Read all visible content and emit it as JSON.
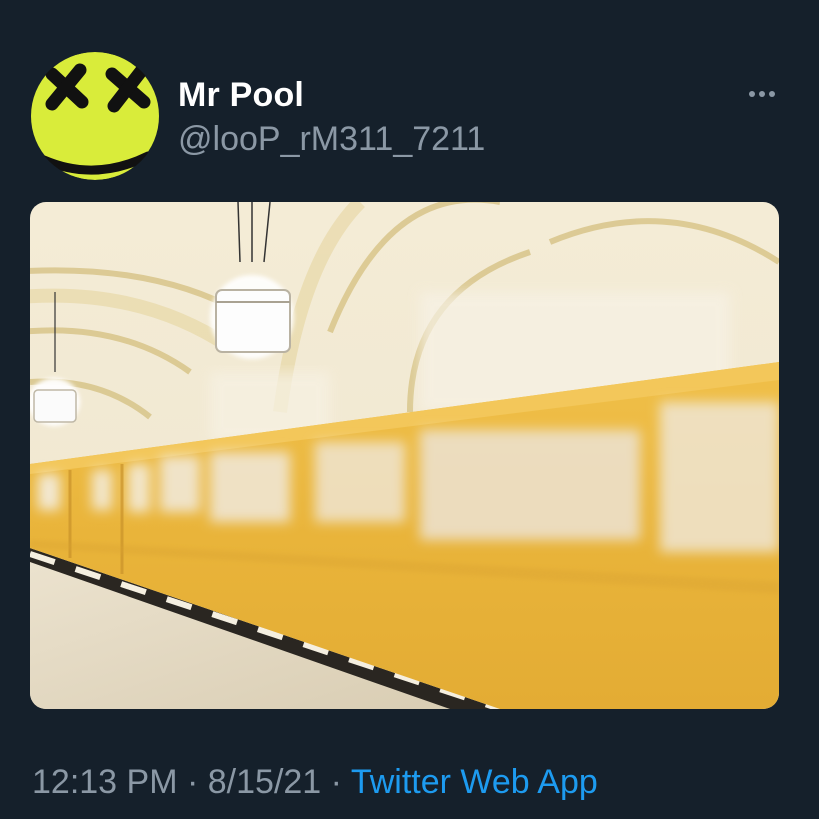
{
  "tweet": {
    "display_name": "Mr Pool",
    "handle": "@looP_rM311_7211",
    "more_icon": "more-horizontal-icon",
    "avatar_icon": "x-eyes-smiley-face-icon",
    "media_description_icon": "subway-train-photo",
    "time": "12:13 PM",
    "separator_1": "·",
    "date": "8/15/21",
    "separator_2": "·",
    "source": "Twitter Web App"
  },
  "colors": {
    "background": "#15202b",
    "name": "#ffffff",
    "secondary_text": "#8b98a5",
    "link": "#1d9bf0",
    "avatar_yellow": "#d9ec3a",
    "train_yellow": "#e8b53a"
  }
}
